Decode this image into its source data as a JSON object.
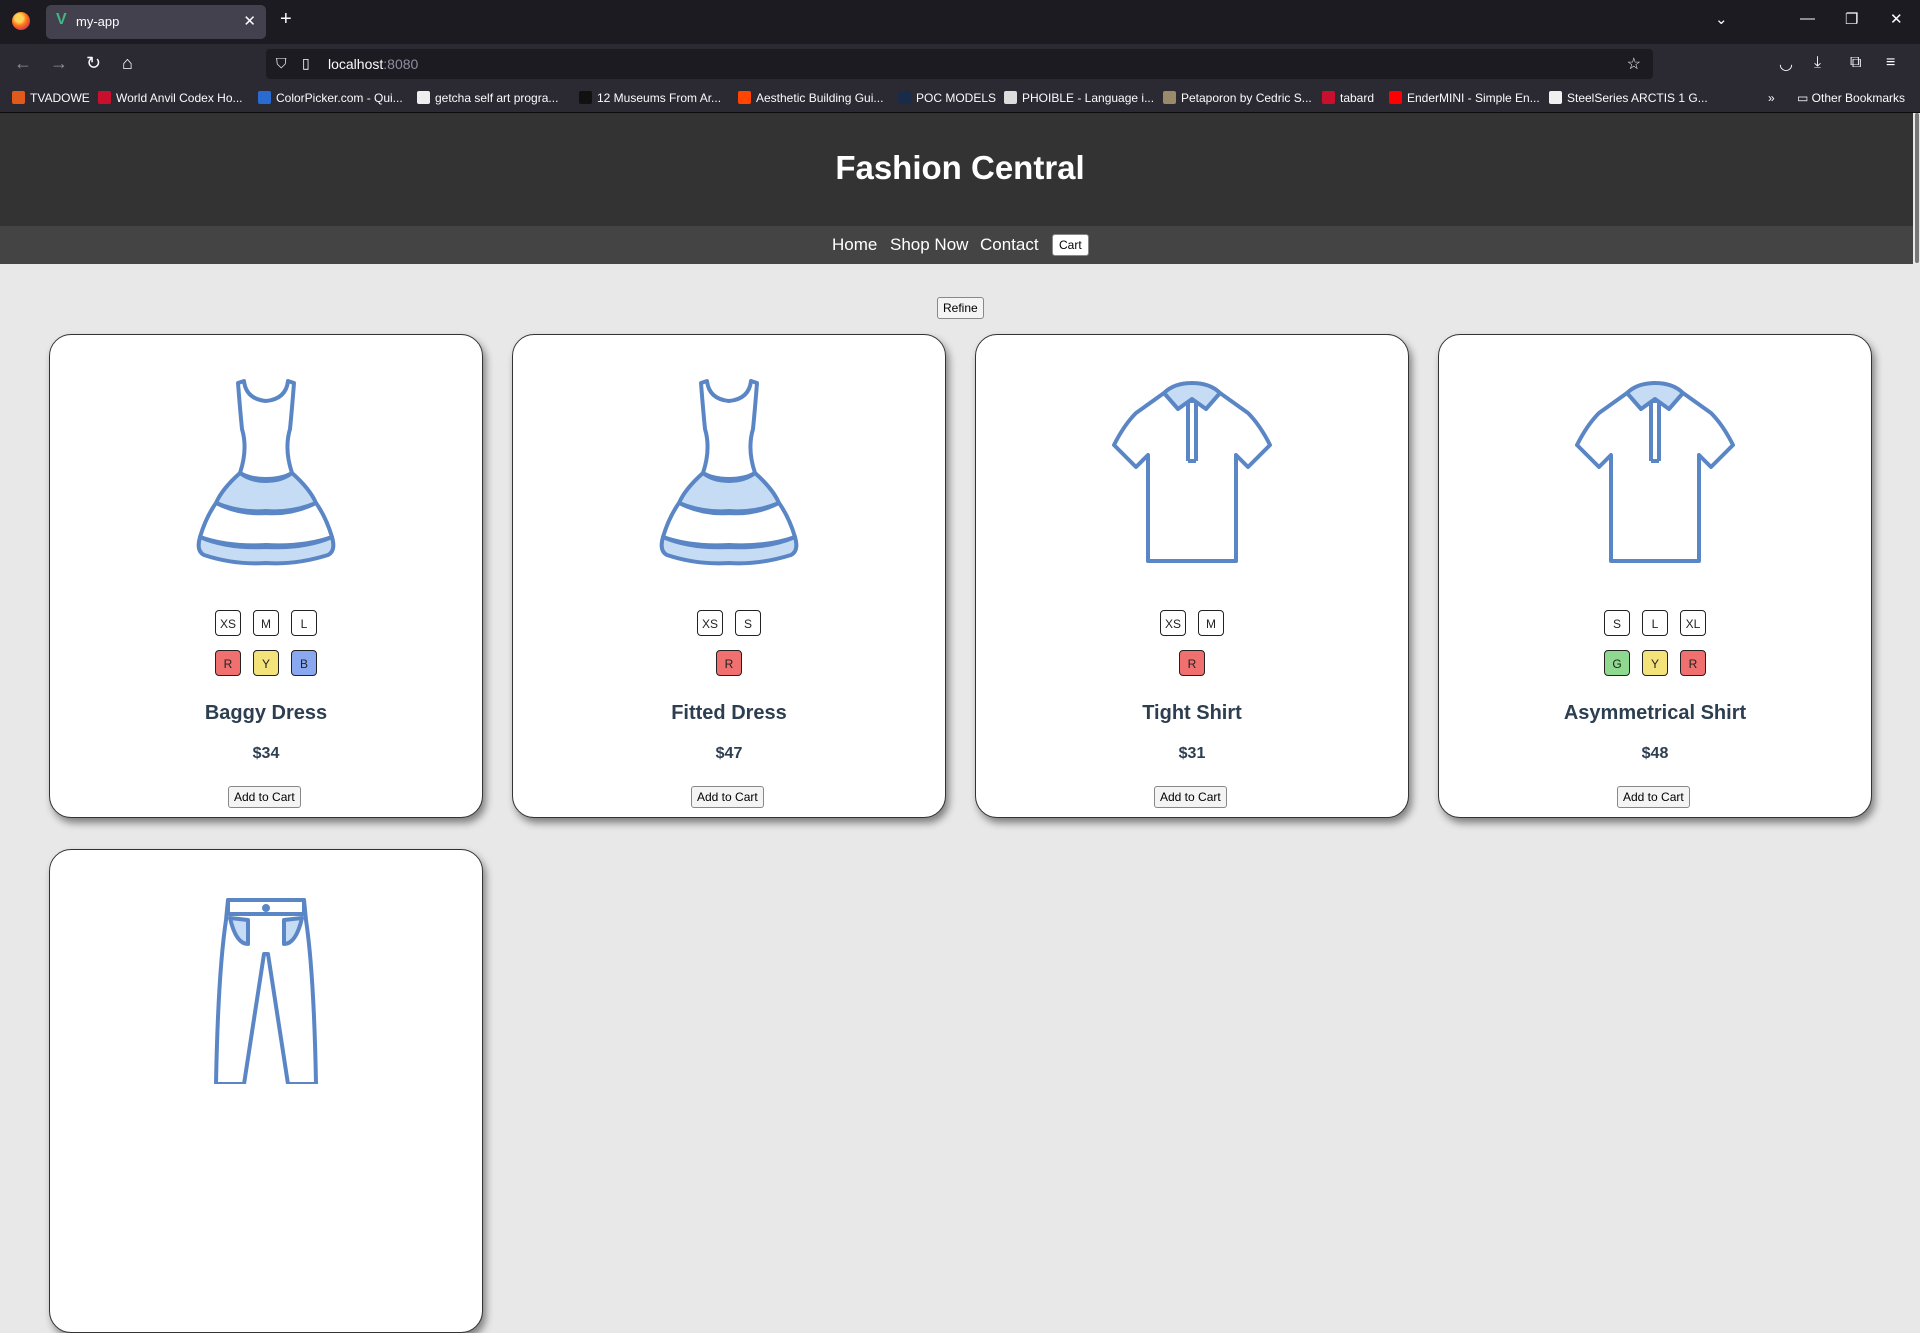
{
  "browser": {
    "tab_title": "my-app",
    "tab_favicon": "V",
    "url_host": "localhost",
    "url_port": ":8080",
    "bookmarks": [
      {
        "label": "TVADOWE",
        "color": "#e05a1b"
      },
      {
        "label": "World Anvil Codex Ho...",
        "color": "#c8102e"
      },
      {
        "label": "ColorPicker.com - Qui...",
        "color": "#2a6bd1"
      },
      {
        "label": "getcha self art progra...",
        "color": "#eeeeee"
      },
      {
        "label": "12 Museums From Ar...",
        "color": "#111111"
      },
      {
        "label": "Aesthetic Building Gui...",
        "color": "#ff4500"
      },
      {
        "label": "POC MODELS",
        "color": "#1a2b4a"
      },
      {
        "label": "PHOIBLE - Language i...",
        "color": "#dddddd"
      },
      {
        "label": "Petaporon by Cedric S...",
        "color": "#9a8a6a"
      },
      {
        "label": "tabard",
        "color": "#c8102e"
      },
      {
        "label": "EnderMINI - Simple En...",
        "color": "#ff0000"
      },
      {
        "label": "SteelSeries ARCTIS 1 G...",
        "color": "#f0f0f0"
      }
    ],
    "other_bookmarks": "Other Bookmarks"
  },
  "site": {
    "title": "Fashion Central",
    "nav": {
      "home": "Home",
      "shop": "Shop Now",
      "contact": "Contact",
      "cart": "Cart"
    },
    "refine": "Refine"
  },
  "products": [
    {
      "name": "Baggy Dress",
      "price": "$34",
      "image": "dress-icon",
      "sizes": [
        "XS",
        "M",
        "L"
      ],
      "colors": [
        {
          "label": "R",
          "hex": "#f07070"
        },
        {
          "label": "Y",
          "hex": "#f4e27a"
        },
        {
          "label": "B",
          "hex": "#8aa8f0"
        }
      ],
      "button": "Add to Cart"
    },
    {
      "name": "Fitted Dress",
      "price": "$47",
      "image": "dress-icon",
      "sizes": [
        "XS",
        "S"
      ],
      "colors": [
        {
          "label": "R",
          "hex": "#f07070"
        }
      ],
      "button": "Add to Cart"
    },
    {
      "name": "Tight Shirt",
      "price": "$31",
      "image": "shirt-icon",
      "sizes": [
        "XS",
        "M"
      ],
      "colors": [
        {
          "label": "R",
          "hex": "#f07070"
        }
      ],
      "button": "Add to Cart"
    },
    {
      "name": "Asymmetrical Shirt",
      "price": "$48",
      "image": "shirt-icon",
      "sizes": [
        "S",
        "L",
        "XL"
      ],
      "colors": [
        {
          "label": "G",
          "hex": "#8fd88f"
        },
        {
          "label": "Y",
          "hex": "#f4e27a"
        },
        {
          "label": "R",
          "hex": "#f07070"
        }
      ],
      "button": "Add to Cart"
    },
    {
      "name": "",
      "price": "",
      "image": "pants-icon",
      "sizes": [],
      "colors": [],
      "button": ""
    }
  ]
}
